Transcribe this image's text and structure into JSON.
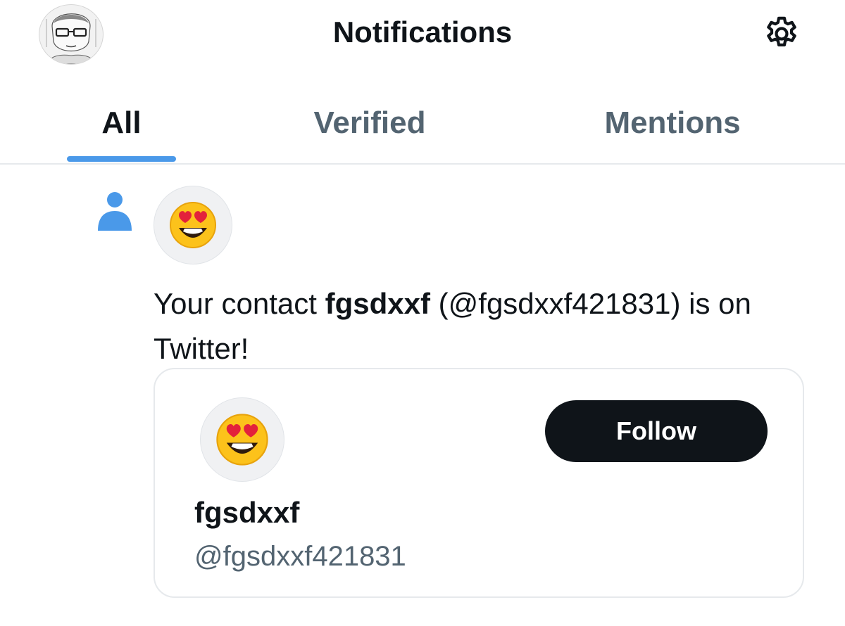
{
  "header": {
    "title": "Notifications",
    "avatar_icon": "user-portrait-sketch",
    "settings_icon": "gear-icon"
  },
  "tabs": [
    {
      "label": "All",
      "active": true
    },
    {
      "label": "Verified",
      "active": false
    },
    {
      "label": "Mentions",
      "active": false
    }
  ],
  "notification": {
    "type_icon": "person-icon",
    "avatar_icon": "smiling-face-with-heart-eyes-emoji",
    "text_prefix": "Your contact ",
    "text_name": "fgsdxxf",
    "text_suffix": " (@fgsdxxf421831) is on Twitter!",
    "card": {
      "name": "fgsdxxf",
      "handle": "@fgsdxxf421831",
      "follow_label": "Follow"
    }
  },
  "colors": {
    "accent": "#4a99e9",
    "text_primary": "#0f1419",
    "text_secondary": "#536471",
    "button_bg": "#0f1419",
    "border": "#e6e9ec"
  }
}
